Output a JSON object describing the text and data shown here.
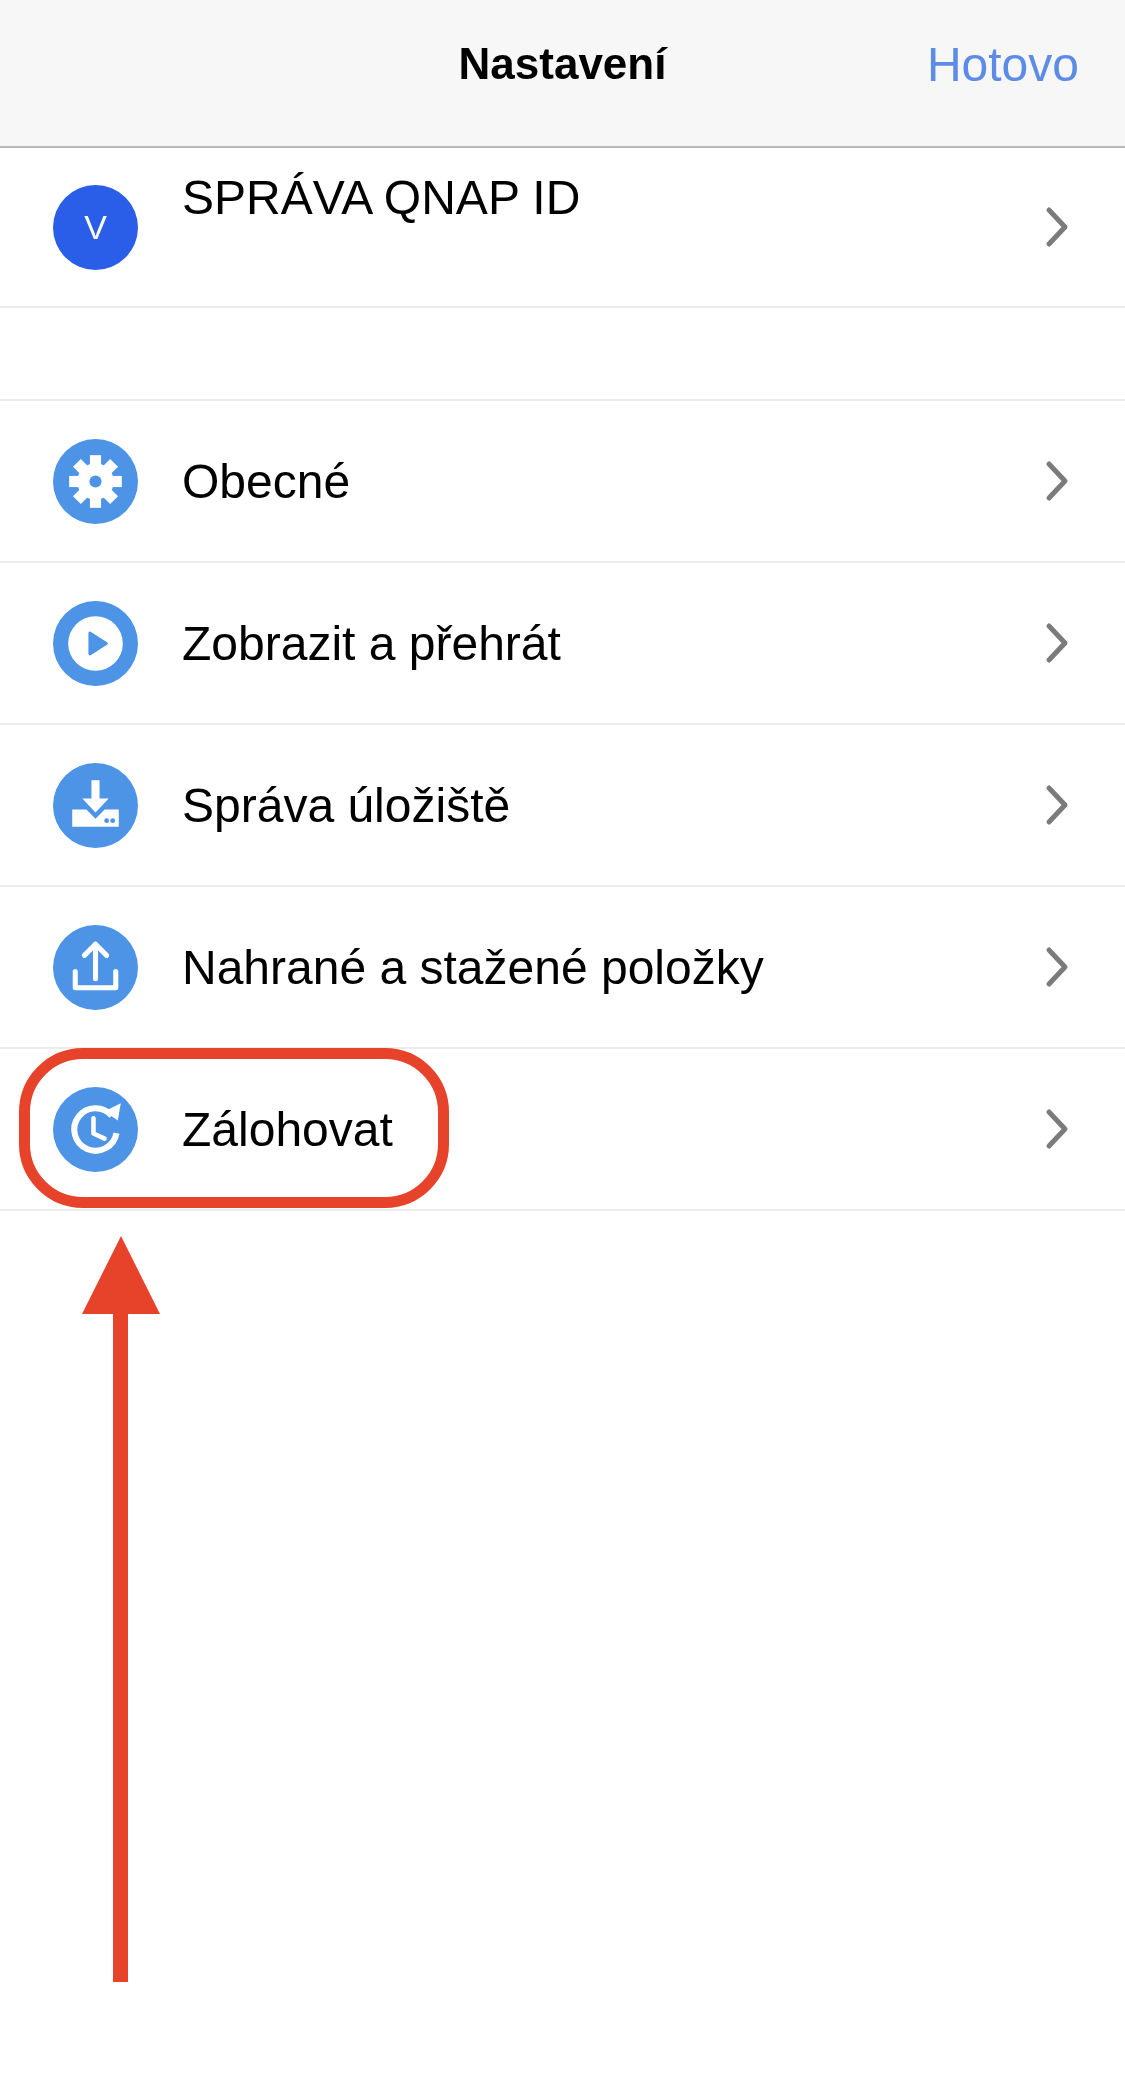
{
  "header": {
    "title": "Nastavení",
    "done_button": "Hotovo"
  },
  "account": {
    "avatar_letter": "V",
    "label": "SPRÁVA QNAP ID"
  },
  "menu": [
    {
      "label": "Obecné",
      "highlighted": false
    },
    {
      "label": "Zobrazit a přehrát",
      "highlighted": false
    },
    {
      "label": "Správa úložiště",
      "highlighted": false
    },
    {
      "label": "Nahrané a stažené položky",
      "highlighted": false
    },
    {
      "label": "Zálohovat",
      "highlighted": true
    }
  ],
  "annotations": [
    {
      "kind": "arrow"
    }
  ]
}
